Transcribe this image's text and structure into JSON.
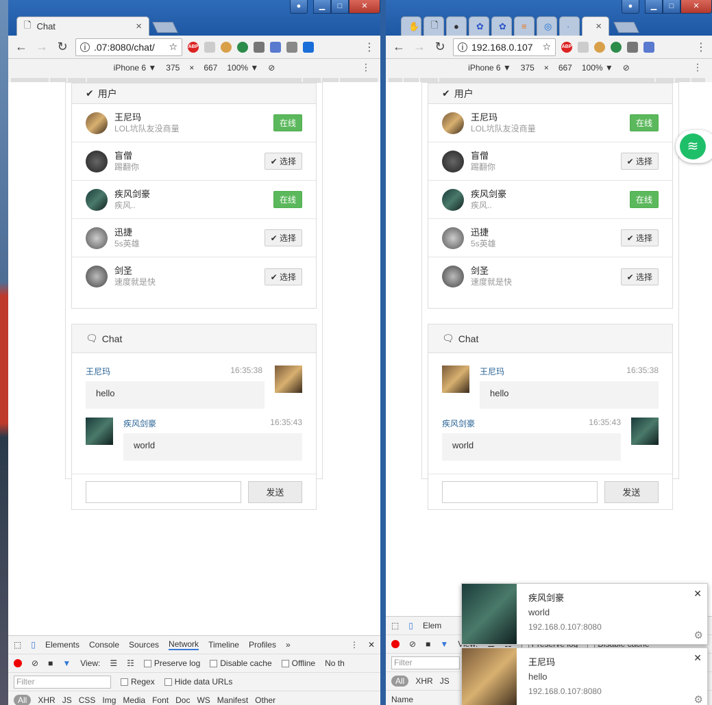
{
  "browser": {
    "left": {
      "tab_title": "Chat",
      "tab_close": "×",
      "url": ".07:8080/chat/",
      "extensions": [
        "ABP",
        "",
        "",
        "",
        "",
        "",
        "",
        ""
      ]
    },
    "right": {
      "url": "192.168.0.107",
      "tab_close": "×",
      "extensions": [
        "ABP",
        "",
        "",
        "",
        "",
        "",
        ""
      ]
    },
    "emulation": {
      "device": "iPhone 6 ▼",
      "width": "375",
      "times": "×",
      "height": "667",
      "zoom": "100% ▼"
    }
  },
  "users_panel": {
    "title": "用户",
    "online_label": "在线",
    "select_label": "选择",
    "users": [
      {
        "name": "王尼玛",
        "signature": "LOL坑队友没商量",
        "status": "online"
      },
      {
        "name": "盲僧",
        "signature": "踢翻你",
        "status": "select"
      },
      {
        "name": "疾风剑豪",
        "signature": "疾风..",
        "status": "online"
      },
      {
        "name": "迅捷",
        "signature": "5s英雄",
        "status": "select"
      },
      {
        "name": "剑圣",
        "signature": "速度就是快",
        "status": "select"
      }
    ]
  },
  "chat_panel": {
    "title": "Chat",
    "send_label": "发送",
    "messages": [
      {
        "sender": "王尼玛",
        "time": "16:35:38",
        "text": "hello"
      },
      {
        "sender": "疾风剑豪",
        "time": "16:35:43",
        "text": "world"
      }
    ]
  },
  "devtools": {
    "tabs": [
      "Elements",
      "Console",
      "Sources",
      "Network",
      "Timeline",
      "Profiles"
    ],
    "more": "»",
    "view_label": "View:",
    "preserve_log": "Preserve log",
    "disable_cache": "Disable cache",
    "offline": "Offline",
    "no_throttle": "No th",
    "filter_placeholder": "Filter",
    "regex": "Regex",
    "hide_data_urls": "Hide data URLs",
    "types": [
      "All",
      "XHR",
      "JS",
      "CSS",
      "Img",
      "Media",
      "Font",
      "Doc",
      "WS",
      "Manifest",
      "Other"
    ],
    "right_tab_partial": "Elem",
    "right_types": [
      "All",
      "XHR",
      "JS"
    ],
    "right_name_col": "Name"
  },
  "notifications": [
    {
      "title": "疾风剑豪",
      "body": "world",
      "source": "192.168.0.107:8080"
    },
    {
      "title": "王尼玛",
      "body": "hello",
      "source": "192.168.0.107:8080"
    }
  ],
  "colors": {
    "online": "#5cb85c",
    "link": "#2a6496",
    "titlebar": "#1e58a4"
  }
}
